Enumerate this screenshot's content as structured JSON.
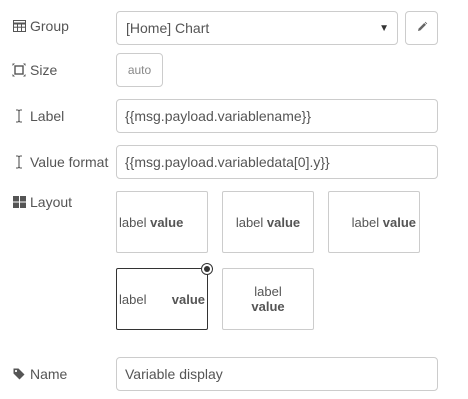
{
  "group": {
    "label": "Group",
    "icon": "table-icon",
    "value": "[Home] Chart",
    "edit_icon": "pencil-icon"
  },
  "size": {
    "label": "Size",
    "icon": "resize-icon",
    "value": "auto"
  },
  "label_field": {
    "label": "Label",
    "icon": "text-cursor-icon",
    "value": "{{msg.payload.variablename}}"
  },
  "value_format": {
    "label": "Value format",
    "icon": "text-cursor-icon",
    "value": "{{msg.payload.variabledata[0].y}}"
  },
  "layout": {
    "label": "Layout",
    "icon": "grid-icon",
    "options": [
      {
        "label": "label",
        "value": "value",
        "style": "left-together"
      },
      {
        "label": "label",
        "value": "value",
        "style": "center-together"
      },
      {
        "label": "label",
        "value": "value",
        "style": "right-together"
      },
      {
        "label": "label",
        "value": "value",
        "style": "spread",
        "selected": true
      },
      {
        "label": "label",
        "value": "value",
        "style": "stacked"
      }
    ]
  },
  "name": {
    "label": "Name",
    "icon": "tag-icon",
    "value": "Variable display"
  }
}
